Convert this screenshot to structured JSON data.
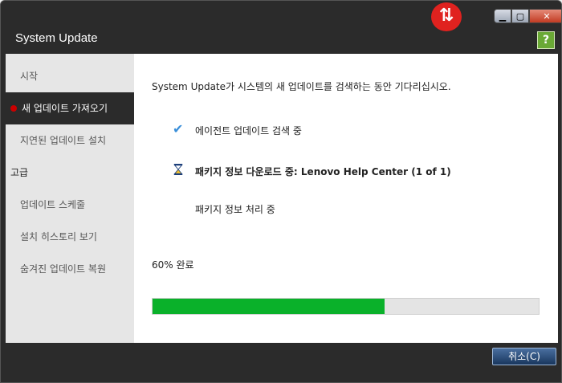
{
  "window": {
    "title": "System Update"
  },
  "sidebar": {
    "items": [
      {
        "label": "시작"
      },
      {
        "label": "새 업데이트 가져오기"
      },
      {
        "label": "지연된 업데이트 설치"
      },
      {
        "label": "고급"
      },
      {
        "label": "업데이트 스케줄"
      },
      {
        "label": "설치 히스토리 보기"
      },
      {
        "label": "숨겨진 업데이트 복원"
      }
    ]
  },
  "main": {
    "intro": "System Update가 시스템의 새 업데이트를 검색하는 동안 기다리십시오.",
    "steps": [
      {
        "label": "에이전트 업데이트 검색 중",
        "status": "done",
        "icon": "check-icon"
      },
      {
        "label": "패키지 정보 다운로드 중: Lenovo Help Center (1 of 1)",
        "status": "in-progress",
        "icon": "hourglass-icon"
      },
      {
        "label": "패키지 정보 처리 중",
        "status": "pending"
      }
    ],
    "progress": {
      "label": "60% 완료",
      "value": 0.6,
      "color": "#0ab12a"
    }
  },
  "footer": {
    "cancel_label": "취소(C)"
  },
  "colors": {
    "accent_red": "#e0221f",
    "check_blue": "#3a8fd9"
  }
}
